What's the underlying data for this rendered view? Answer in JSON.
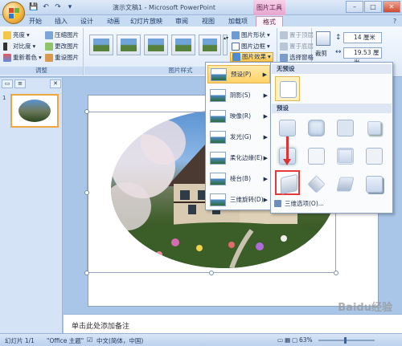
{
  "window": {
    "title": "演示文稿1 - Microsoft PowerPoint",
    "context_tab_group": "图片工具",
    "minimize": "–",
    "maximize": "□",
    "close": "✕"
  },
  "tabs": [
    "开始",
    "插入",
    "设计",
    "动画",
    "幻灯片放映",
    "审阅",
    "视图",
    "加载项",
    "格式"
  ],
  "ribbon": {
    "adjust": {
      "label": "调整",
      "brightness": "亮度",
      "contrast": "对比度",
      "recolor": "重新着色",
      "compress": "压缩图片",
      "change": "更改图片",
      "reset": "重设图片"
    },
    "picture_styles": {
      "label": "图片样式",
      "shape": "图片形状",
      "border": "图片边框",
      "effects": "图片效果"
    },
    "arrange": {
      "bring_front": "置于顶层",
      "send_back": "置于底层",
      "selection_pane": "选择窗格"
    },
    "size": {
      "crop": "裁剪",
      "height": "14 厘米",
      "width": "19.53 厘米"
    }
  },
  "effects_menu": {
    "items": [
      {
        "label": "预设(P)",
        "hovered": true
      },
      {
        "label": "阴影(S)",
        "hovered": false
      },
      {
        "label": "映像(R)",
        "hovered": false
      },
      {
        "label": "发光(G)",
        "hovered": false
      },
      {
        "label": "柔化边缘(E)",
        "hovered": false
      },
      {
        "label": "棱台(B)",
        "hovered": false
      },
      {
        "label": "三维旋转(D)",
        "hovered": false
      }
    ]
  },
  "preset_panel": {
    "no_preset_header": "无预设",
    "preset_header": "预设",
    "three_d_options": "三维选项(O)...",
    "selected_index": 8
  },
  "left_pane": {
    "slide_number": "1"
  },
  "notes": {
    "placeholder": "单击此处添加备注"
  },
  "status": {
    "slide": "幻灯片 1/1",
    "theme": "\"Office 主题\"",
    "language": "中文(简体，中国)",
    "zoom": "63%"
  },
  "watermark": "Baidu经验",
  "colors": {
    "accent_highlight": "#ffd267",
    "context_tab": "#e7a4cf",
    "annotation_red": "#dd3333"
  }
}
